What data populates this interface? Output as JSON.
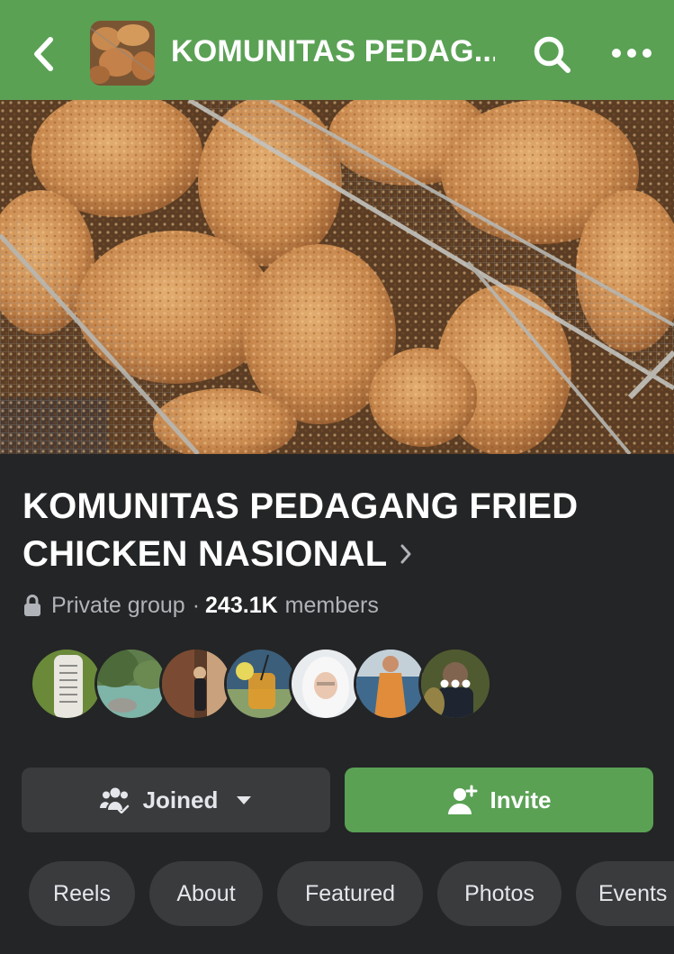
{
  "header": {
    "title": "KOMUNITAS PEDAG...",
    "back_icon": "chevron-left-icon",
    "search_icon": "search-icon",
    "more_icon": "more-horizontal-icon",
    "bar_color": "#5aa154"
  },
  "group": {
    "name": "KOMUNITAS PEDAGANG FRIED CHICKEN NASIONAL",
    "privacy": "Private group",
    "separator": "·",
    "member_count": "243.1K",
    "members_label": "members"
  },
  "member_avatars": {
    "overflow_icon": "more-horizontal-icon"
  },
  "actions": {
    "joined_label": "Joined",
    "invite_label": "Invite"
  },
  "tabs": [
    {
      "label": "Reels"
    },
    {
      "label": "About"
    },
    {
      "label": "Featured"
    },
    {
      "label": "Photos"
    },
    {
      "label": "Events"
    }
  ],
  "colors": {
    "accent": "#5aa154",
    "background": "#242526",
    "surface": "#3a3b3c"
  }
}
